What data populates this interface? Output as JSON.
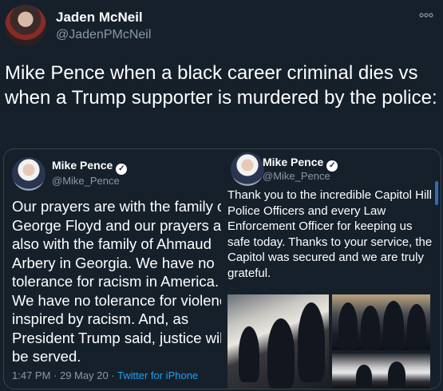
{
  "tweet": {
    "author_name": "Jaden McNeil",
    "author_handle": "@JadenPMcNeil",
    "more_icon": "more-icon",
    "text": "Mike Pence when a black career criminal dies vs when a Trump supporter is murdered by the police:"
  },
  "quoted": {
    "left": {
      "author_name": "Mike Pence",
      "author_handle": "@Mike_Pence",
      "verified_icon": "verified-badge-icon",
      "text": "Our prayers are with the family of\nGeorge Floyd and our prayers are\nalso with the family of Ahmaud\nArbery in Georgia. We have no\ntolerance for racism in America.\nWe have no tolerance for violence\ninspired by racism. And, as\nPresident Trump said, justice will\nbe served.",
      "time": "1:47 PM · 29 May 20 · ",
      "source": "Twitter for iPhone"
    },
    "right": {
      "author_name": "Mike Pence",
      "author_handle": "@Mike_Pence",
      "verified_icon": "verified-badge-icon",
      "text": "Thank you to the incredible Capitol Hill Police Officers and every Law Enforcement Officer for keeping us safe today. Thanks to your service, the Capitol was secured and we are truly grateful."
    }
  },
  "colors": {
    "background": "#15202b",
    "secondary_text": "#8899a6",
    "link": "#1da1f2",
    "border": "#38444d"
  }
}
